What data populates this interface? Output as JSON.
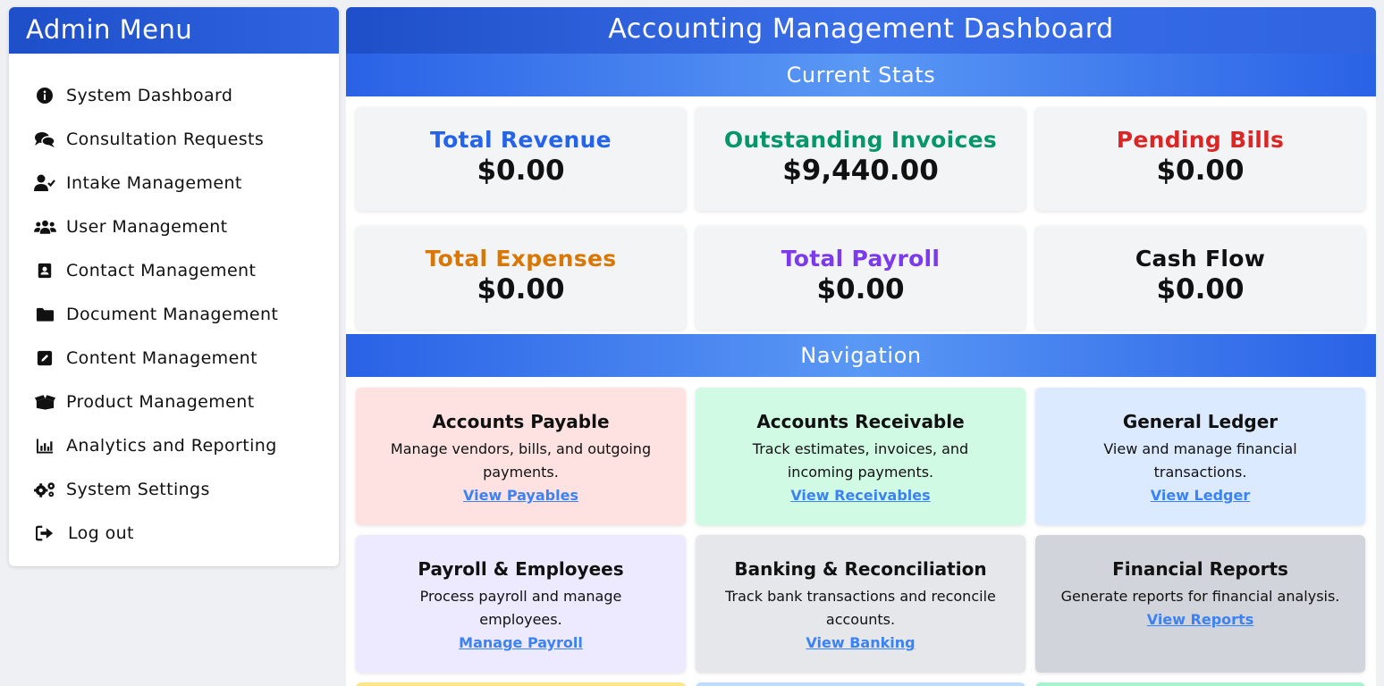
{
  "sidebar": {
    "title": "Admin Menu",
    "items": [
      {
        "label": "System Dashboard",
        "icon": "info-circle-icon"
      },
      {
        "label": "Consultation Requests",
        "icon": "comments-icon"
      },
      {
        "label": "Intake Management",
        "icon": "user-check-icon"
      },
      {
        "label": "User Management",
        "icon": "users-icon"
      },
      {
        "label": "Contact Management",
        "icon": "address-book-icon"
      },
      {
        "label": "Document Management",
        "icon": "folder-icon"
      },
      {
        "label": "Content Management",
        "icon": "edit-icon"
      },
      {
        "label": "Product Management",
        "icon": "box-open-icon"
      },
      {
        "label": "Analytics and Reporting",
        "icon": "chart-bar-icon"
      },
      {
        "label": "System Settings",
        "icon": "cogs-icon"
      },
      {
        "label": "Log out",
        "icon": "sign-out-icon"
      }
    ]
  },
  "main": {
    "title": "Accounting Management Dashboard",
    "stats_heading": "Current Stats",
    "stats": [
      {
        "title": "Total Revenue",
        "value": "$0.00",
        "color": "#2563eb"
      },
      {
        "title": "Outstanding Invoices",
        "value": "$9,440.00",
        "color": "#059669"
      },
      {
        "title": "Pending Bills",
        "value": "$0.00",
        "color": "#dc2626"
      },
      {
        "title": "Total Expenses",
        "value": "$0.00",
        "color": "#d97706"
      },
      {
        "title": "Total Payroll",
        "value": "$0.00",
        "color": "#7c3aed"
      },
      {
        "title": "Cash Flow",
        "value": "$0.00",
        "color": "#111111"
      }
    ],
    "nav_heading": "Navigation",
    "nav_cards": [
      {
        "title": "Accounts Payable",
        "desc": "Manage vendors, bills, and outgoing payments.",
        "link": "View Payables",
        "bg": "#fee2e2"
      },
      {
        "title": "Accounts Receivable",
        "desc": "Track estimates, invoices, and incoming payments.",
        "link": "View Receivables",
        "bg": "#d1fae5"
      },
      {
        "title": "General Ledger",
        "desc": "View and manage financial transactions.",
        "link": "View Ledger",
        "bg": "#dbeafe"
      },
      {
        "title": "Payroll & Employees",
        "desc": "Process payroll and manage employees.",
        "link": "Manage Payroll",
        "bg": "#ede9fe"
      },
      {
        "title": "Banking & Reconciliation",
        "desc": "Track bank transactions and reconcile accounts.",
        "link": "View Banking",
        "bg": "#e5e7eb"
      },
      {
        "title": "Financial Reports",
        "desc": "Generate reports for financial analysis.",
        "link": "View Reports",
        "bg": "#d1d5db"
      }
    ],
    "partial_row_colors": [
      "#fde68a",
      "#bfdbfe",
      "#a7f3d0"
    ]
  }
}
